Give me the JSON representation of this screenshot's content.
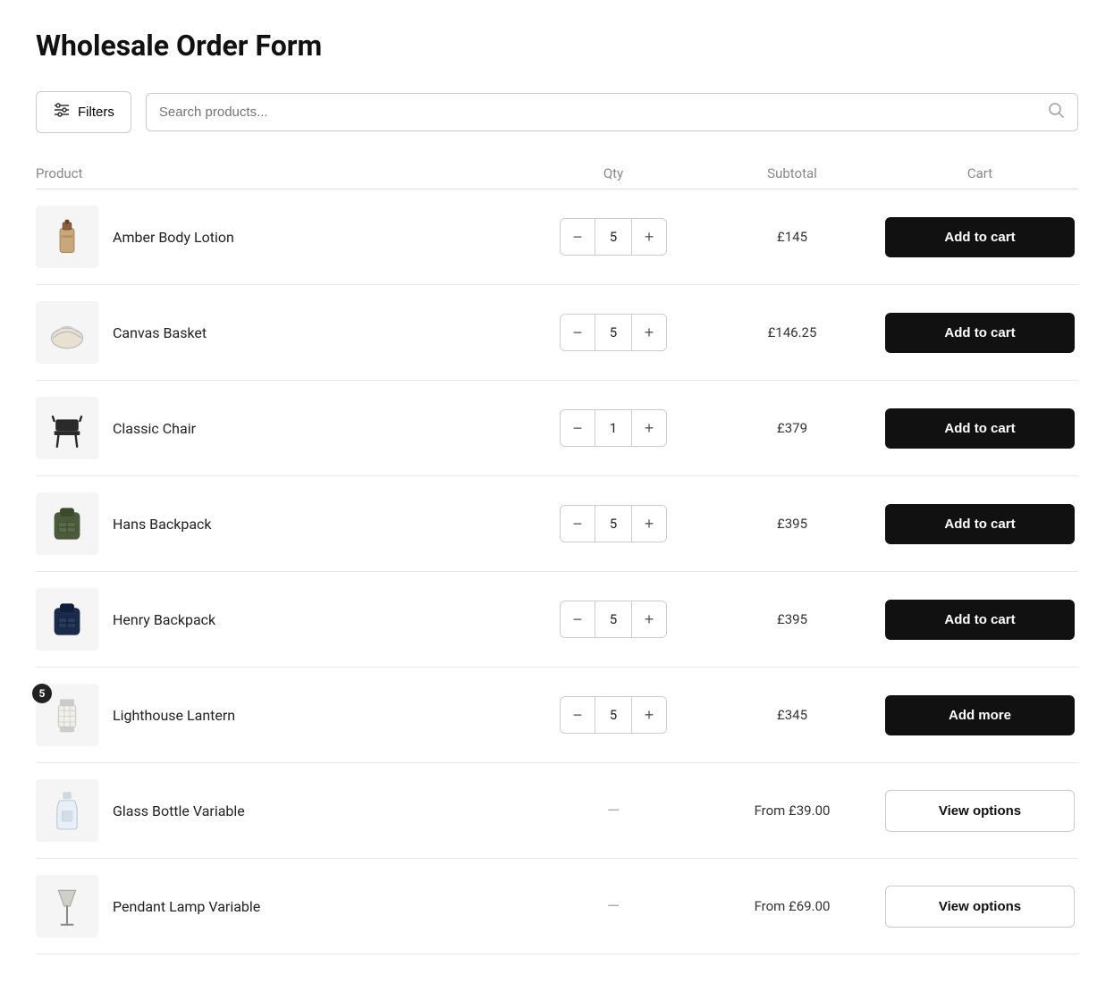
{
  "page": {
    "title": "Wholesale Order Form"
  },
  "toolbar": {
    "filters_label": "Filters",
    "search_placeholder": "Search products..."
  },
  "table": {
    "headers": {
      "product": "Product",
      "qty": "Qty",
      "subtotal": "Subtotal",
      "cart": "Cart"
    }
  },
  "products": [
    {
      "id": "amber-body-lotion",
      "name": "Amber Body Lotion",
      "qty": 5,
      "subtotal": "£145",
      "action": "add_to_cart",
      "action_label": "Add to cart",
      "badge": null,
      "icon_type": "lotion"
    },
    {
      "id": "canvas-basket",
      "name": "Canvas Basket",
      "qty": 5,
      "subtotal": "£146.25",
      "action": "add_to_cart",
      "action_label": "Add to cart",
      "badge": null,
      "icon_type": "basket"
    },
    {
      "id": "classic-chair",
      "name": "Classic Chair",
      "qty": 1,
      "subtotal": "£379",
      "action": "add_to_cart",
      "action_label": "Add to cart",
      "badge": null,
      "icon_type": "chair"
    },
    {
      "id": "hans-backpack",
      "name": "Hans Backpack",
      "qty": 5,
      "subtotal": "£395",
      "action": "add_to_cart",
      "action_label": "Add to cart",
      "badge": null,
      "icon_type": "backpack_green"
    },
    {
      "id": "henry-backpack",
      "name": "Henry Backpack",
      "qty": 5,
      "subtotal": "£395",
      "action": "add_to_cart",
      "action_label": "Add to cart",
      "badge": null,
      "icon_type": "backpack_navy"
    },
    {
      "id": "lighthouse-lantern",
      "name": "Lighthouse Lantern",
      "qty": 5,
      "subtotal": "£345",
      "action": "add_more",
      "action_label": "Add more",
      "badge": "5",
      "icon_type": "lantern"
    },
    {
      "id": "glass-bottle-variable",
      "name": "Glass Bottle Variable",
      "qty": null,
      "subtotal": "From £39.00",
      "action": "view_options",
      "action_label": "View options",
      "badge": null,
      "icon_type": "bottle"
    },
    {
      "id": "pendant-lamp-variable",
      "name": "Pendant Lamp Variable",
      "qty": null,
      "subtotal": "From £69.00",
      "action": "view_options",
      "action_label": "View options",
      "badge": null,
      "icon_type": "lamp"
    }
  ]
}
